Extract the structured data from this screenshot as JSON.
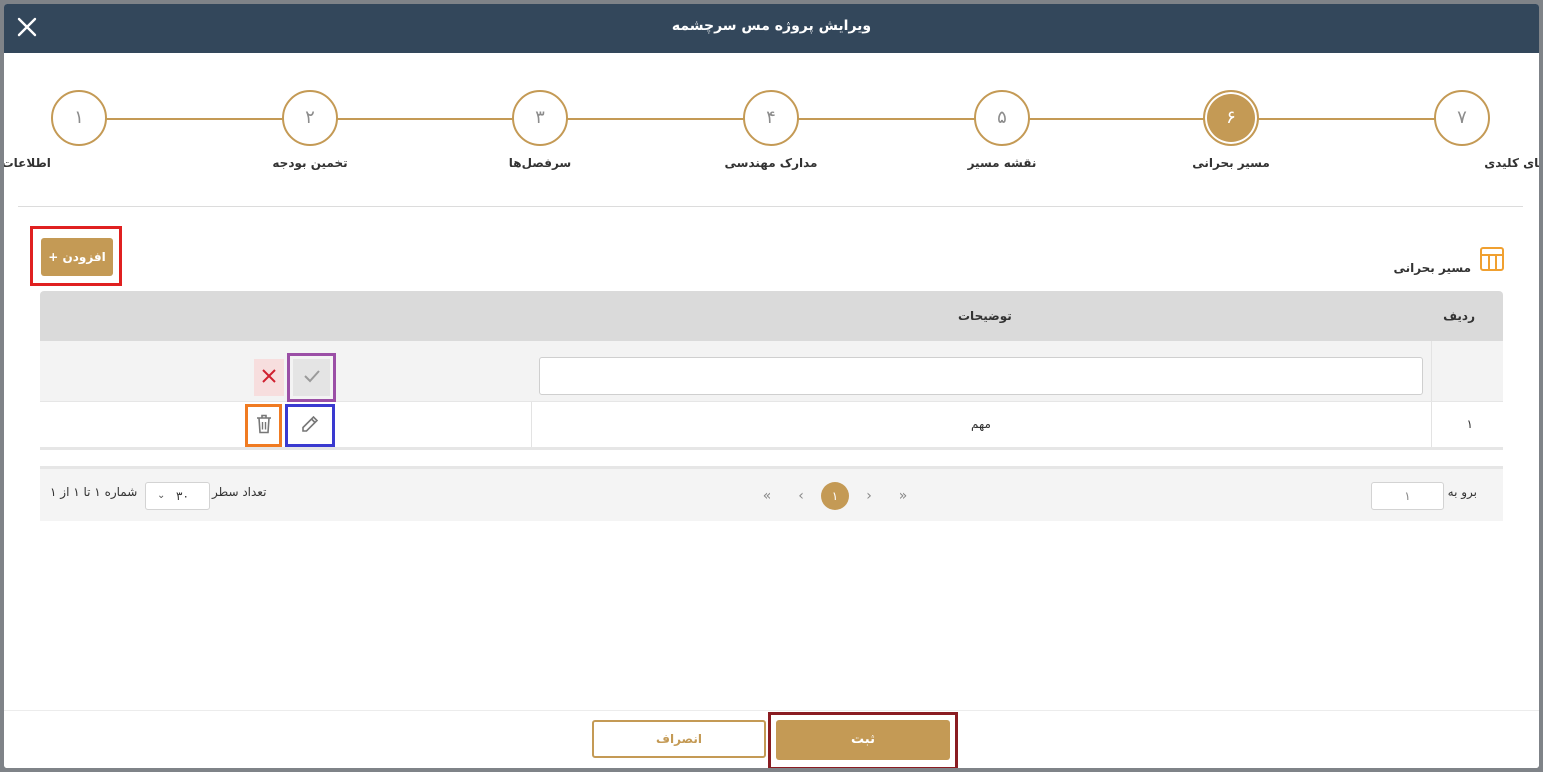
{
  "modal": {
    "title": "ویرایش پروژه مس سرچشمه"
  },
  "stepper": {
    "steps": [
      {
        "number": "۱",
        "label": "اطلاعات پروژه",
        "active": false
      },
      {
        "number": "۲",
        "label": "تخمین بودجه",
        "active": false
      },
      {
        "number": "۳",
        "label": "سرفصل‌ها",
        "active": false
      },
      {
        "number": "۴",
        "label": "مدارک مهندسی",
        "active": false
      },
      {
        "number": "۵",
        "label": "نقشه مسیر",
        "active": false
      },
      {
        "number": "۶",
        "label": "مسیر بحرانی",
        "active": true
      },
      {
        "number": "۷",
        "label": "تاریخ‌های کلیدی",
        "active": false
      }
    ]
  },
  "section": {
    "title": "مسیر بحرانی",
    "add_label": "+ افزودن"
  },
  "table": {
    "columns": {
      "index": "ردیف",
      "description": "توضیحات"
    },
    "edit_row": {
      "description_value": ""
    },
    "rows": [
      {
        "index": "۱",
        "description": "مهم"
      }
    ]
  },
  "pager": {
    "goto_label": "برو به",
    "goto_value": "۱",
    "current_page": "۱",
    "rows_label": "تعداد سطر",
    "rows_per_page": "۳۰",
    "info": "شماره ۱ تا ۱ از ۱"
  },
  "footer": {
    "cancel_label": "انصراف",
    "submit_label": "ثبت"
  },
  "colors": {
    "accent": "#c49a55",
    "header": "#33475b",
    "highlight_add": "#e02020",
    "highlight_confirm": "#9b4fa6",
    "highlight_edit": "#3a3ad0",
    "highlight_delete": "#f07b22",
    "highlight_submit": "#8a1c22"
  }
}
